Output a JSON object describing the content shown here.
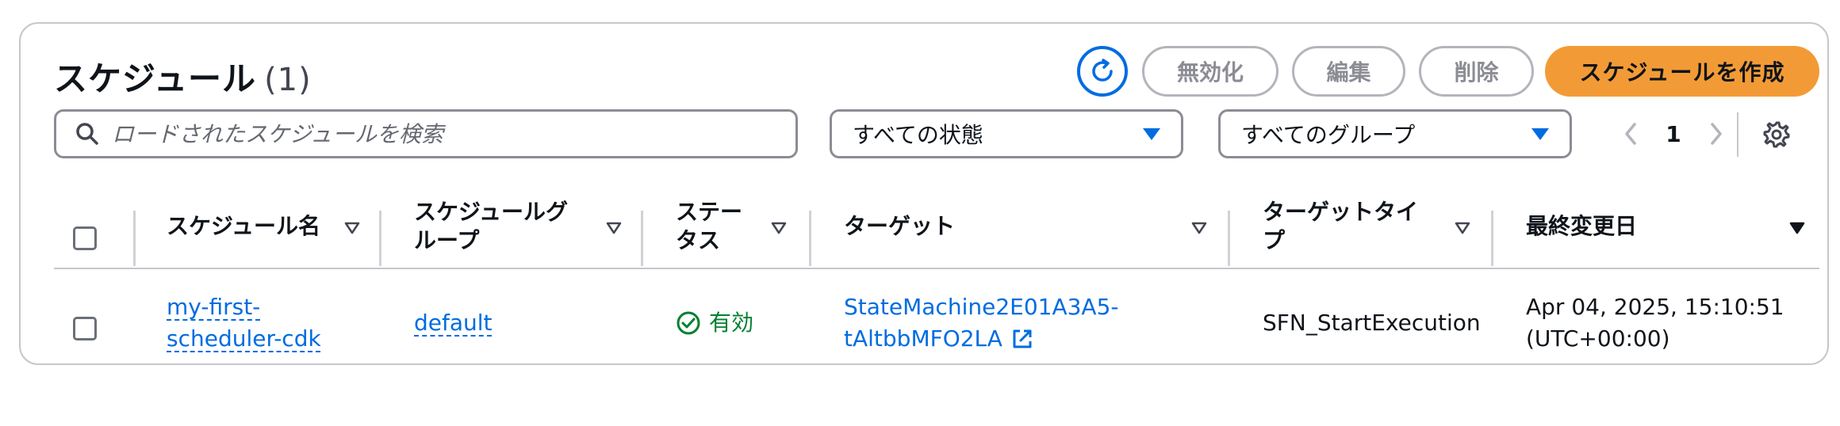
{
  "header": {
    "title": "スケジュール",
    "count": "(1)",
    "buttons": {
      "disable": "無効化",
      "edit": "編集",
      "delete": "削除",
      "create": "スケジュールを作成"
    }
  },
  "filters": {
    "search_placeholder": "ロードされたスケジュールを検索",
    "state_select": "すべての状態",
    "group_select": "すべてのグループ"
  },
  "pagination": {
    "current_page": "1"
  },
  "table": {
    "columns": [
      "スケジュール名",
      "スケジュールグ\nループ",
      "ステー\nタス",
      "ターゲット",
      "ターゲットタイ\nプ",
      "最終変更日"
    ],
    "rows": [
      {
        "name_line1": "my-first-",
        "name_line2": "scheduler-cdk",
        "group": "default",
        "status": "有効",
        "target_line1": "StateMachine2E01A3A5-",
        "target_line2": "tAltbbMFO2LA",
        "target_type": "SFN_StartExecution",
        "modified_line1": "Apr 04, 2025, 15:10:51",
        "modified_line2": "(UTC+00:00)"
      }
    ]
  },
  "colors": {
    "accent": "#006ce0",
    "primary_button": "#f29b36",
    "status_ok": "#00802f",
    "border": "#8c8c94"
  },
  "icons": [
    "refresh-icon",
    "search-icon",
    "caret-down-icon",
    "chevron-left-icon",
    "chevron-right-icon",
    "gear-icon",
    "sort-icon",
    "check-circle-icon",
    "external-link-icon"
  ]
}
